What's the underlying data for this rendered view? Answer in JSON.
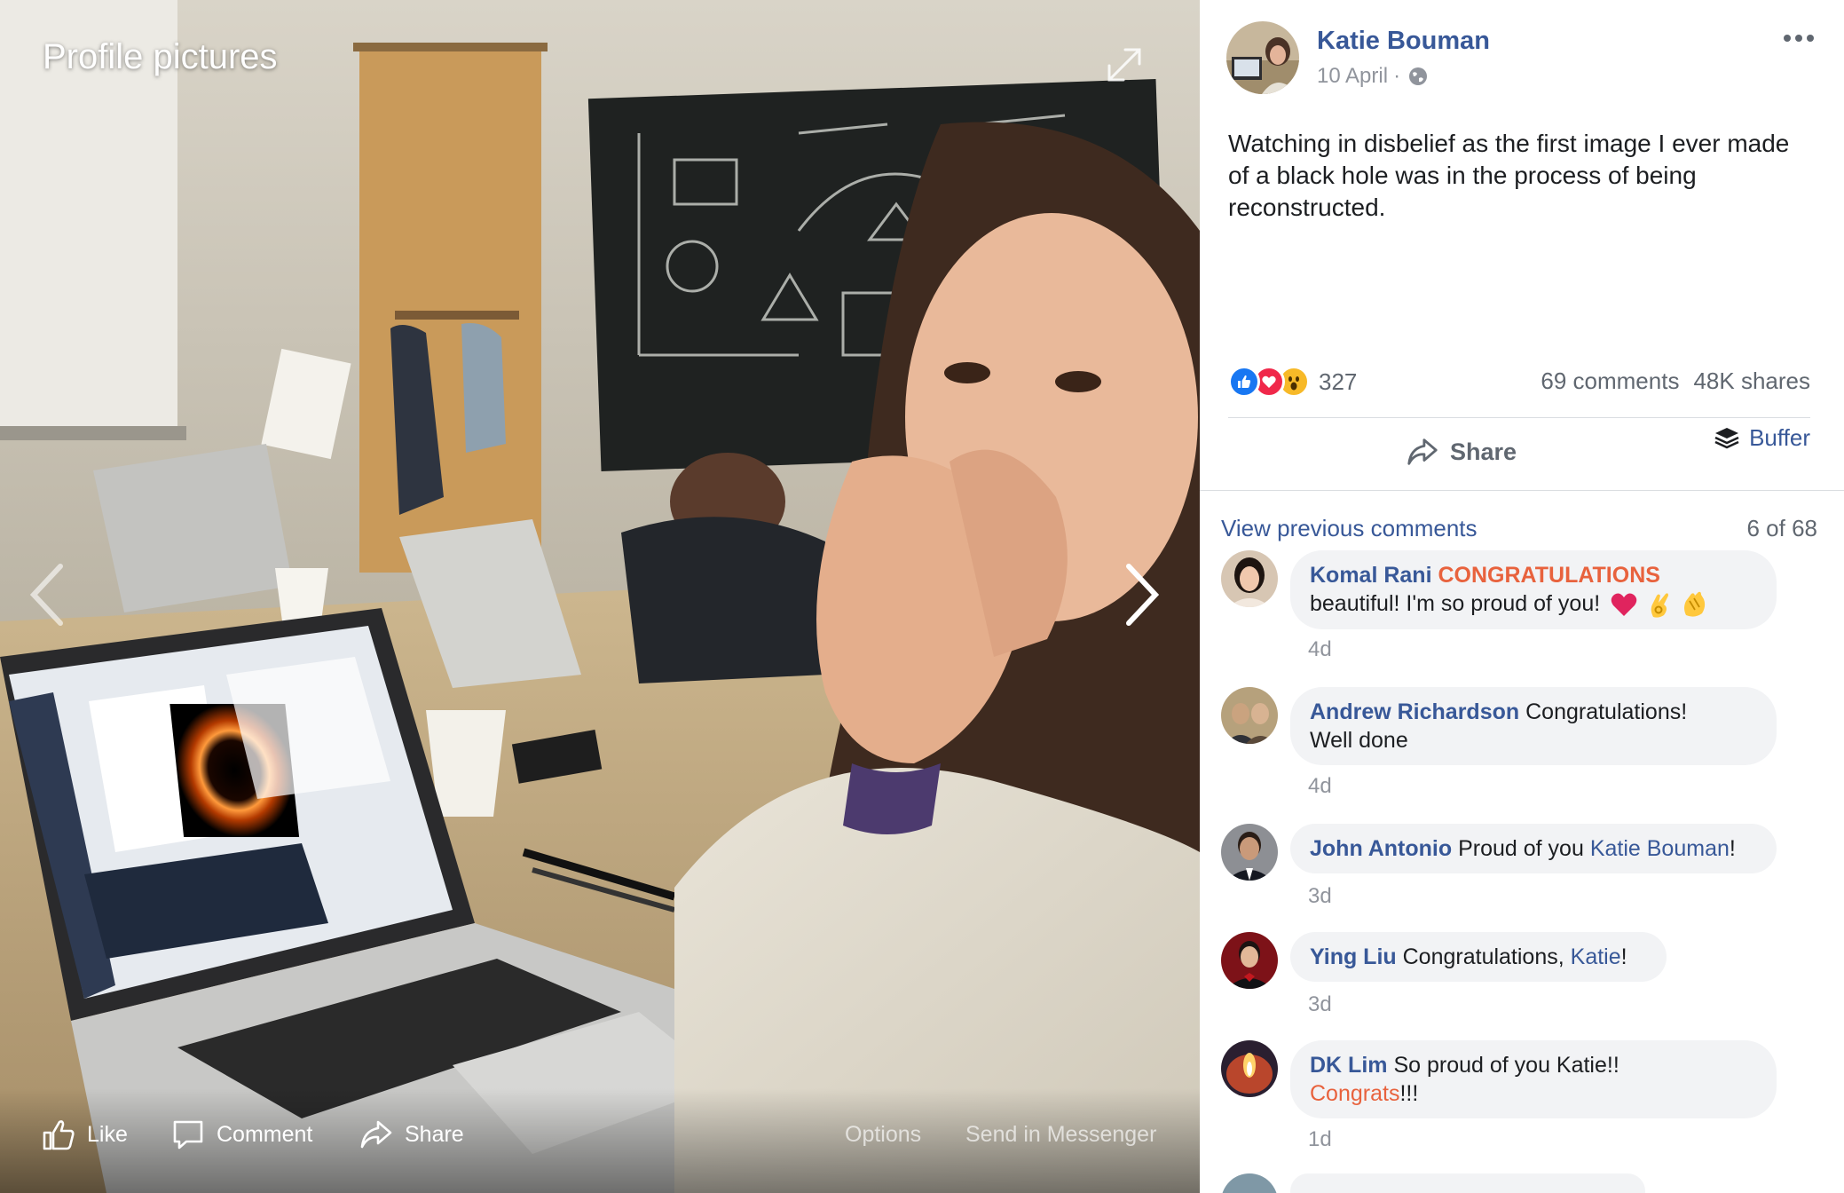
{
  "viewer": {
    "title": "Profile pictures",
    "actions": {
      "like": "Like",
      "comment": "Comment",
      "share": "Share",
      "options": "Options",
      "send": "Send in Messenger"
    }
  },
  "post": {
    "author": "Katie Bouman",
    "date": "10 April",
    "date_separator": "·",
    "text": "Watching in disbelief as the first image I ever made of a black hole was in the process of being reconstructed.",
    "reaction_count": "327",
    "comments_count": "69 comments",
    "shares_count": "48K shares",
    "share_label": "Share",
    "buffer_label": "Buffer",
    "icons": {
      "like": "thumbs-up-icon",
      "love": "heart-icon",
      "wow": "wow-face-icon",
      "privacy": "globe-icon",
      "more": "more-options-icon"
    },
    "colors": {
      "link": "#385898",
      "highlight": "#e8623d",
      "like_blue": "#1877f2",
      "love_red": "#f0284a",
      "wow_yellow": "#f7b928"
    }
  },
  "comments_header": {
    "view_previous": "View previous comments",
    "count": "6 of 68"
  },
  "comments": [
    {
      "name": "Komal Rani",
      "highlight": "CONGRATULATIONS",
      "line2": "beautiful! I'm so proud of you!",
      "time": "4d"
    },
    {
      "name": "Andrew Richardson",
      "text": "Congratulations!",
      "line2": "Well done",
      "time": "4d"
    },
    {
      "name": "John Antonio",
      "text": "Proud of you",
      "mention": "Katie Bouman",
      "suffix": "!",
      "time": "3d"
    },
    {
      "name": "Ying Liu",
      "text": "Congratulations,",
      "mention": "Katie",
      "suffix": "!",
      "time": "3d"
    },
    {
      "name": "DK Lim",
      "text": "So proud of you Katie!!",
      "highlight": "Congrats",
      "suffix": "!!!",
      "time": "1d"
    }
  ]
}
